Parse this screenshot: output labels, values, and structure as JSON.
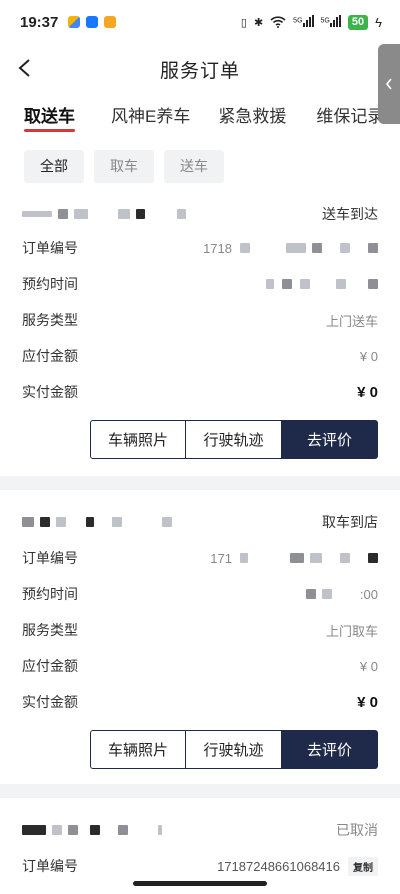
{
  "status": {
    "time": "19:37",
    "net1": "5G",
    "net2": "5G",
    "battery": "50"
  },
  "header": {
    "title": "服务订单",
    "back_icon": "chevron-left-icon"
  },
  "side_handle_icon": "chevron-left-icon",
  "tabs": [
    {
      "label": "取送车",
      "active": true
    },
    {
      "label": "风神E养车",
      "active": false
    },
    {
      "label": "紧急救援",
      "active": false
    },
    {
      "label": "维保记录",
      "active": false
    }
  ],
  "filters": [
    {
      "label": "全部",
      "active": true
    },
    {
      "label": "取车",
      "active": false
    },
    {
      "label": "送车",
      "active": false
    }
  ],
  "labels": {
    "order_no": "订单编号",
    "appoint_time": "预约时间",
    "service_type": "服务类型",
    "payable": "应付金额",
    "paid": "实付金额",
    "copy": "复制"
  },
  "orders": [
    {
      "state": "送车到达",
      "order_no_prefix": "1718",
      "service_type": "上门送车",
      "payable": "¥ 0",
      "paid": "¥ 0",
      "actions": [
        "车辆照片",
        "行驶轨迹",
        "去评价"
      ]
    },
    {
      "state": "取车到店",
      "order_no_prefix": "171",
      "appoint_suffix": ":00",
      "service_type": "上门取车",
      "payable": "¥ 0",
      "paid": "¥ 0",
      "actions": [
        "车辆照片",
        "行驶轨迹",
        "去评价"
      ]
    },
    {
      "state": "已取消",
      "order_no": "17187248661068416"
    }
  ]
}
